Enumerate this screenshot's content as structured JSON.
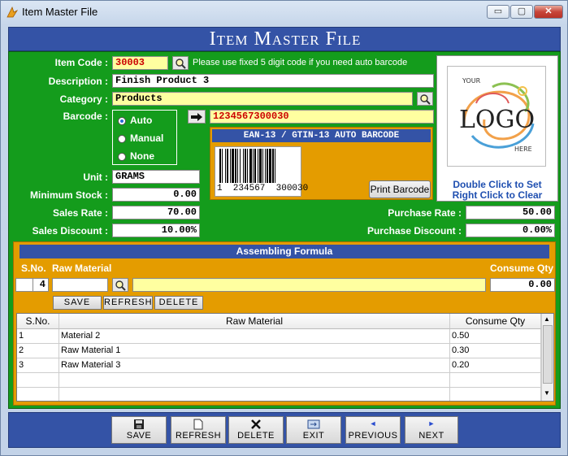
{
  "window": {
    "title": "Item Master File",
    "minimize": "▭",
    "maximize": "▢",
    "close": "✕"
  },
  "header": {
    "title": "Item Master File"
  },
  "form": {
    "item_code_label": "Item Code :",
    "item_code": "30003",
    "item_code_hint": "Please use fixed 5 digit code if you need auto barcode",
    "description_label": "Description :",
    "description": "Finish Product 3",
    "category_label": "Category :",
    "category": "Products",
    "barcode_label": "Barcode :",
    "barcode_modes": [
      {
        "label": "Auto",
        "selected": true
      },
      {
        "label": "Manual",
        "selected": false
      },
      {
        "label": "None",
        "selected": false
      }
    ],
    "barcode_value": "1234567300030",
    "barcode_type": "EAN-13 / GTIN-13 AUTO BARCODE",
    "barcode_human": "1  234567  300030",
    "print_barcode": "Print Barcode",
    "unit_label": "Unit :",
    "unit": "GRAMS",
    "min_stock_label": "Minimum Stock :",
    "min_stock": "0.00",
    "sales_rate_label": "Sales Rate :",
    "sales_rate": "70.00",
    "sales_discount_label": "Sales Discount :",
    "sales_discount": "10.00%",
    "purchase_rate_label": "Purchase Rate :",
    "purchase_rate": "50.00",
    "purchase_discount_label": "Purchase Discount :",
    "purchase_discount": "0.00%"
  },
  "logo": {
    "text_top": "YOUR",
    "text_main": "LOGO",
    "text_bottom": "HERE",
    "hint1": "Double Click to Set",
    "hint2": "Right Click to Clear"
  },
  "assembling": {
    "title": "Assembling Formula",
    "sno_label": "S.No.",
    "raw_material_label": "Raw Material",
    "consume_qty_label": "Consume Qty",
    "sno_value": "4",
    "consume_qty_value": "0.00",
    "buttons": {
      "save": "SAVE",
      "refresh": "REFRESH",
      "delete": "DELETE"
    },
    "grid_headers": [
      "S.No.",
      "Raw Material",
      "Consume Qty"
    ],
    "rows": [
      {
        "sno": "1",
        "material": "Material 2",
        "qty": "0.50"
      },
      {
        "sno": "2",
        "material": "Raw Material 1",
        "qty": "0.30"
      },
      {
        "sno": "3",
        "material": "Raw Material 3",
        "qty": "0.20"
      }
    ]
  },
  "toolbar": {
    "save": "SAVE",
    "refresh": "REFRESH",
    "delete": "DELETE",
    "exit": "EXIT",
    "previous": "PREVIOUS",
    "next": "NEXT"
  },
  "colors": {
    "header": "#3453a6",
    "panel": "#149c1c",
    "accent": "#e49c00",
    "highlight": "#ffffa0",
    "barcode_text": "#cc0000"
  }
}
